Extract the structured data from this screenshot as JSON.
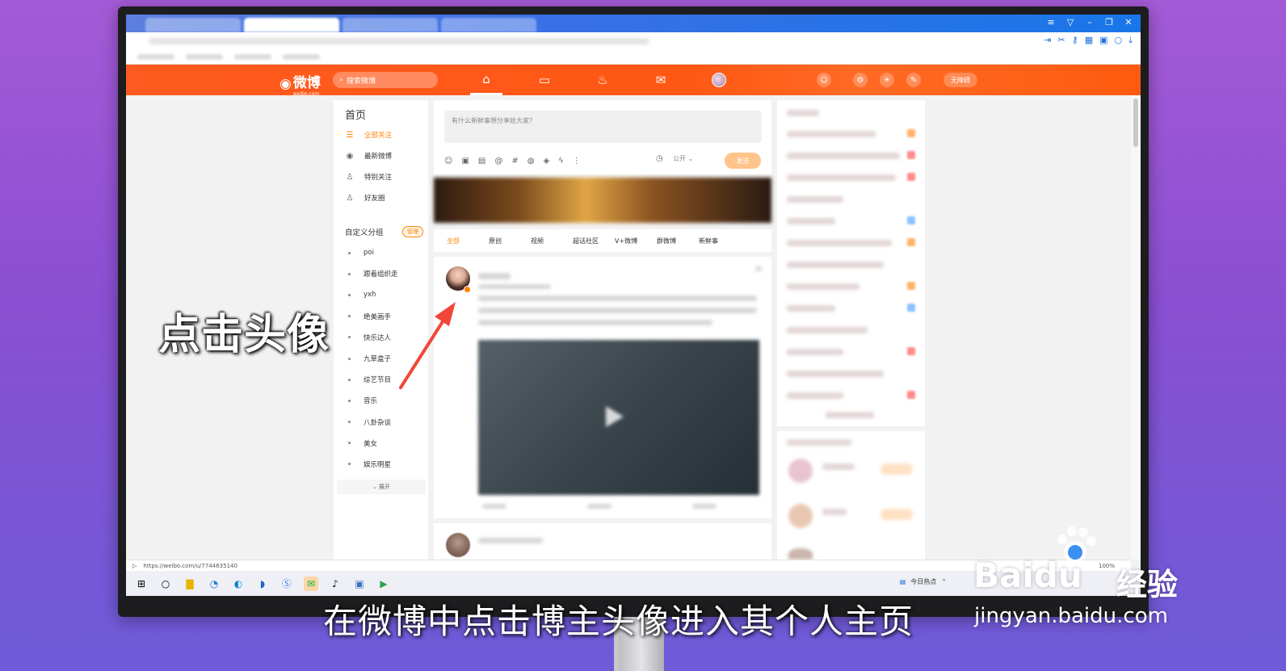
{
  "overlay": {
    "caption": "点击头像",
    "subtitle": "在微博中点击博主头像进入其个人主页",
    "watermark_brand": "Baidu",
    "watermark_cn": "经验",
    "watermark_url": "jingyan.baidu.com"
  },
  "header": {
    "logo_text": "微博",
    "logo_sub": "weibo.com",
    "search_placeholder": "搜索微博",
    "nav_icons": [
      "home-icon",
      "video-icon",
      "hot-icon",
      "message-icon",
      "avatar"
    ],
    "no_popup": "无障碍"
  },
  "sidebar": {
    "title": "首页",
    "items": [
      {
        "label": "全部关注",
        "icon": "list-icon",
        "active": true
      },
      {
        "label": "最新微博",
        "icon": "clock-icon",
        "active": false
      },
      {
        "label": "特别关注",
        "icon": "user-star-icon",
        "active": false
      },
      {
        "label": "好友圈",
        "icon": "friends-icon",
        "active": false
      }
    ],
    "group_title": "自定义分组",
    "manage_label": "管理",
    "groups": [
      "poi",
      "跟着组织走",
      "yxh",
      "绝美画手",
      "快乐达人",
      "九草盒子",
      "综艺节目",
      "音乐",
      "八卦杂谈",
      "美女",
      "娱乐明星"
    ],
    "expand_label": "展开"
  },
  "composer": {
    "placeholder": "有什么新鲜事想分享给大家?",
    "visibility": "公开",
    "send_label": "发送"
  },
  "filters": [
    "全部",
    "原创",
    "视频",
    "超话社区",
    "V+微博",
    "群微博",
    "新鲜事"
  ],
  "status_bar": {
    "url": "https://weibo.com/u/7744635140",
    "zoom": "100%"
  },
  "taskbar": {
    "news_label": "今日热点"
  },
  "colors": {
    "weibo_orange": "#ff5a1f",
    "accent": "#ff8200"
  }
}
